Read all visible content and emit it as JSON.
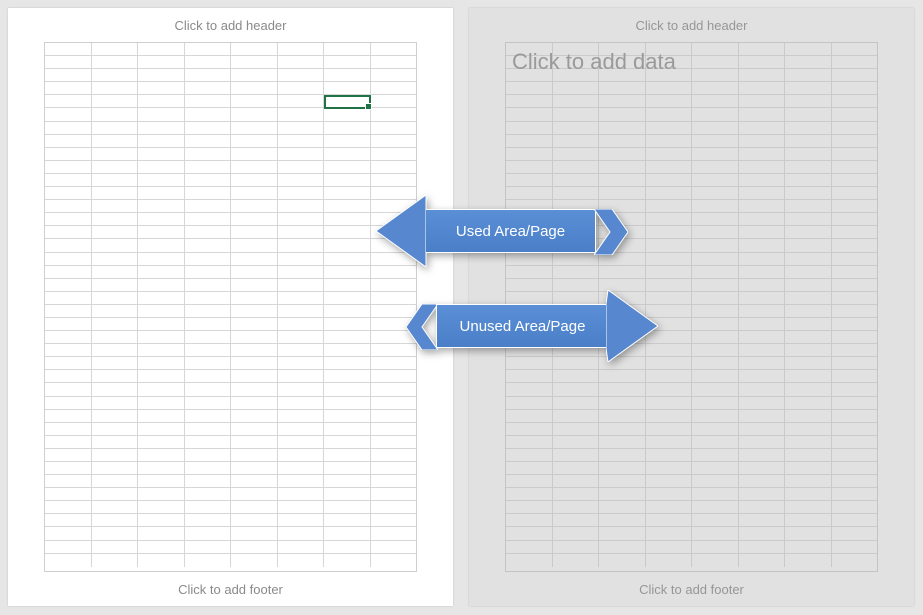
{
  "pages": {
    "left": {
      "header_placeholder": "Click to add header",
      "footer_placeholder": "Click to add footer"
    },
    "right": {
      "header_placeholder": "Click to add header",
      "footer_placeholder": "Click to add footer",
      "watermark": "Click to add data"
    }
  },
  "annotations": {
    "used_label": "Used Area/Page",
    "unused_label": "Unused Area/Page"
  },
  "grid": {
    "columns": 8,
    "rows": 40
  },
  "active_cell": {
    "column_index": 6,
    "row_index": 4
  },
  "colors": {
    "arrow_fill": "#5687cf",
    "selection": "#217346"
  }
}
